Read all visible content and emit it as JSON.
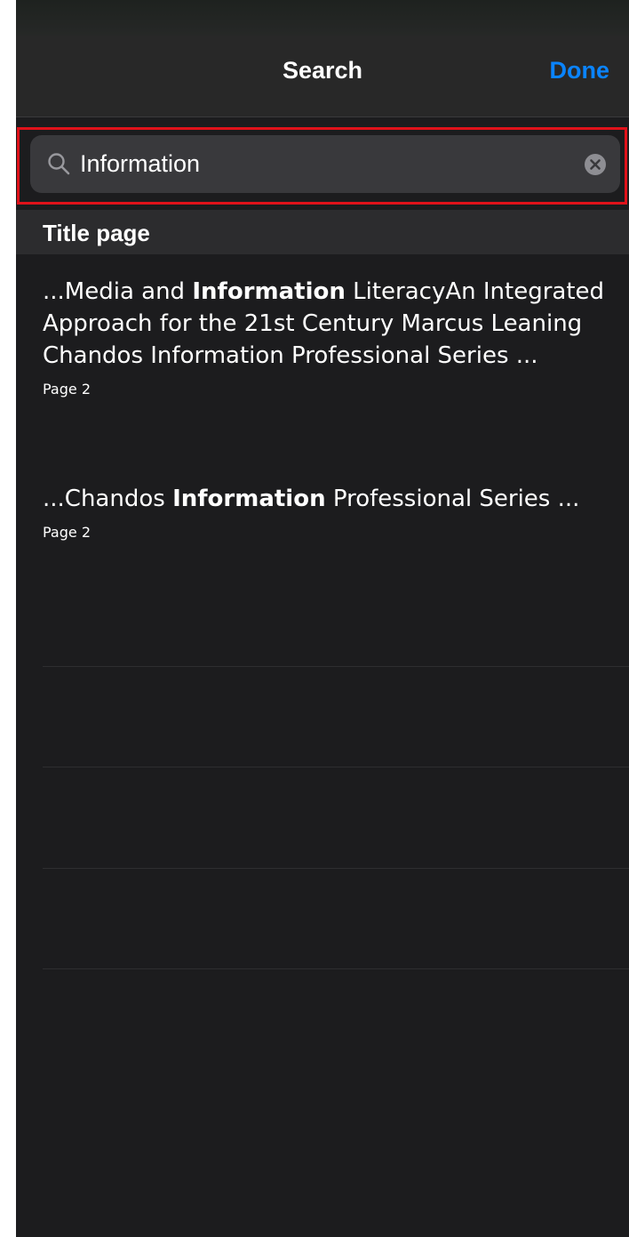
{
  "nav": {
    "title": "Search",
    "done_label": "Done"
  },
  "search": {
    "value": "Information",
    "placeholder": "",
    "icon": "search-icon",
    "clear_icon": "clear-icon"
  },
  "section": {
    "title": "Title page"
  },
  "results": [
    {
      "prefix": "...Media and ",
      "match": "Information",
      "suffix": " LiteracyAn Integrated Approach for the 21st Century Marcus Leaning Chandos Information Professional Series ...",
      "page": "Page 2"
    },
    {
      "prefix": "...Chandos ",
      "match": "Information",
      "suffix": " Professional Series ...",
      "page": "Page 2"
    }
  ],
  "colors": {
    "background": "#1c1c1e",
    "nav_background": "#282828",
    "accent": "#0a84ff",
    "highlight_border": "#e0121a"
  }
}
